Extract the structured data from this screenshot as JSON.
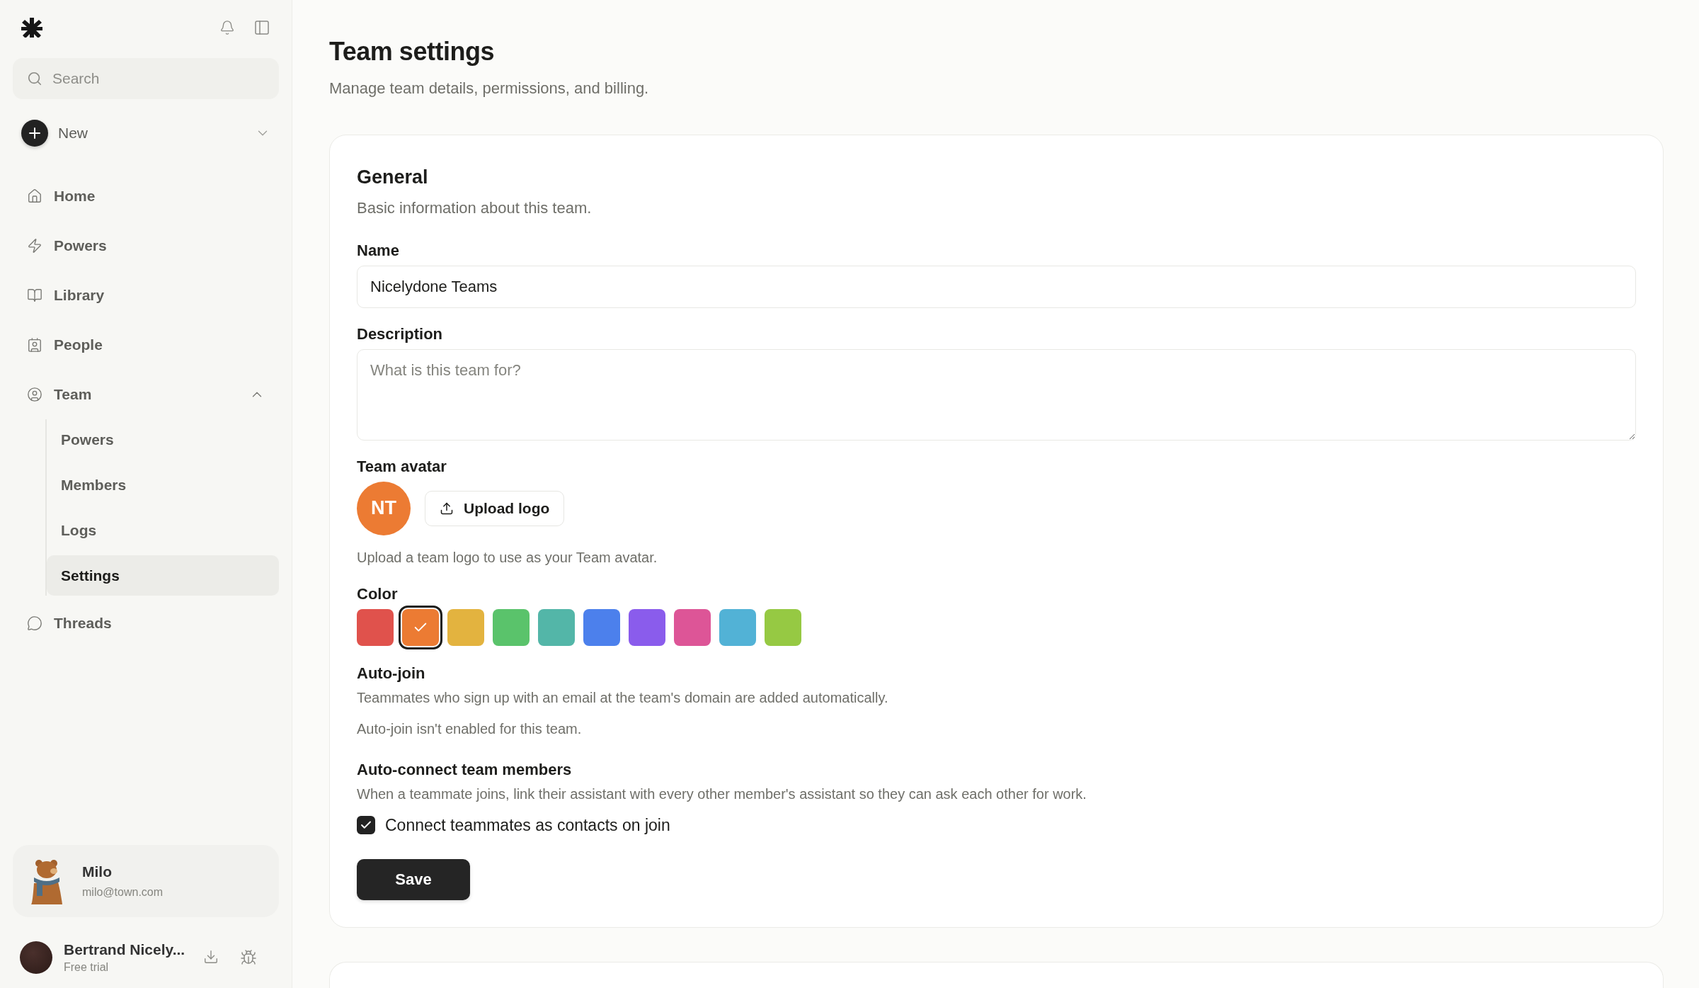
{
  "sidebar": {
    "search": {
      "placeholder": "Search"
    },
    "new_button": {
      "label": "New"
    },
    "nav": [
      {
        "label": "Home",
        "selected": false
      },
      {
        "label": "Powers",
        "selected": false
      },
      {
        "label": "Library",
        "selected": false
      },
      {
        "label": "People",
        "selected": false
      },
      {
        "label": "Team",
        "selected": false,
        "expanded": true,
        "children": [
          {
            "label": "Powers",
            "selected": false
          },
          {
            "label": "Members",
            "selected": false
          },
          {
            "label": "Logs",
            "selected": false
          },
          {
            "label": "Settings",
            "selected": true
          }
        ]
      },
      {
        "label": "Threads",
        "selected": false
      }
    ],
    "assistant": {
      "name": "Milo",
      "email": "milo@town.com"
    },
    "user": {
      "name": "Bertrand Nicely...",
      "plan": "Free trial"
    }
  },
  "page": {
    "title": "Team settings",
    "subtitle": "Manage team details, permissions, and billing."
  },
  "general": {
    "title": "General",
    "description": "Basic information about this team.",
    "name": {
      "label": "Name",
      "value": "Nicelydone Teams"
    },
    "description_field": {
      "label": "Description",
      "placeholder": "What is this team for?"
    },
    "avatar": {
      "label": "Team avatar",
      "initials": "NT",
      "upload_button": "Upload logo",
      "help": "Upload a team logo to use as your Team avatar."
    },
    "color": {
      "label": "Color",
      "swatches": [
        {
          "color": "#e0524c",
          "selected": false
        },
        {
          "color": "#ec7b33",
          "selected": true
        },
        {
          "color": "#e3b33f",
          "selected": false
        },
        {
          "color": "#5ac36b",
          "selected": false
        },
        {
          "color": "#53b6a8",
          "selected": false
        },
        {
          "color": "#4c80ec",
          "selected": false
        },
        {
          "color": "#8a5cec",
          "selected": false
        },
        {
          "color": "#dd5597",
          "selected": false
        },
        {
          "color": "#52b2d6",
          "selected": false
        },
        {
          "color": "#96c943",
          "selected": false
        }
      ]
    },
    "auto_join": {
      "title": "Auto-join",
      "description": "Teammates who sign up with an email at the team's domain are added automatically.",
      "status": "Auto-join isn't enabled for this team."
    },
    "auto_connect": {
      "title": "Auto-connect team members",
      "description": "When a teammate joins, link their assistant with every other member's assistant so they can ask each other for work.",
      "checkbox": {
        "label": "Connect teammates as contacts on join",
        "checked": true
      }
    },
    "save_button": "Save"
  }
}
